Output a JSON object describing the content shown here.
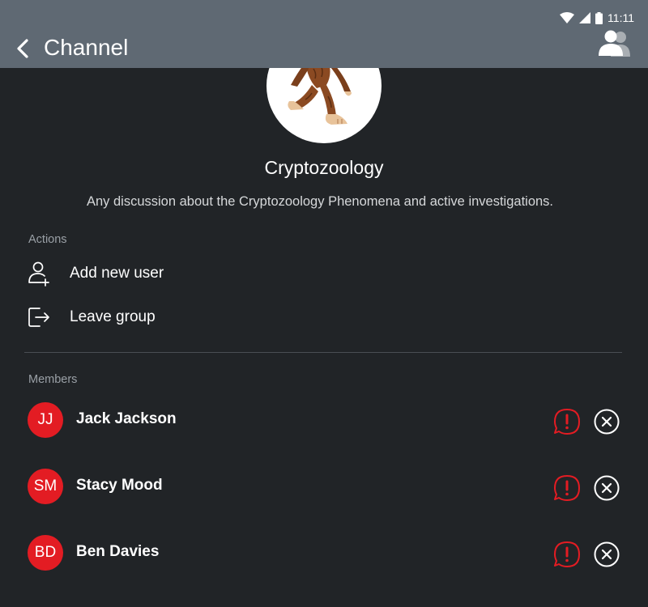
{
  "status_bar": {
    "time": "11:11"
  },
  "app_bar": {
    "title": "Channel",
    "back_icon": "chevron-left-icon",
    "members_icon": "group-icon"
  },
  "channel": {
    "name": "Cryptozoology",
    "description": "Any discussion about the Cryptozoology Phenomena and active investigations.",
    "avatar_icon": "bigfoot-illustration"
  },
  "actions": {
    "label": "Actions",
    "items": [
      {
        "label": "Add new user",
        "icon": "add-user-icon"
      },
      {
        "label": "Leave group",
        "icon": "leave-group-icon"
      }
    ]
  },
  "members": {
    "label": "Members",
    "items": [
      {
        "initials": "JJ",
        "name": "Jack Jackson"
      },
      {
        "initials": "SM",
        "name": "Stacy Mood"
      },
      {
        "initials": "BD",
        "name": "Ben Davies"
      }
    ]
  },
  "colors": {
    "app_bar": "#5f6973",
    "background": "#212427",
    "accent_red": "#e31c23",
    "muted_text": "#9aa0a6"
  }
}
